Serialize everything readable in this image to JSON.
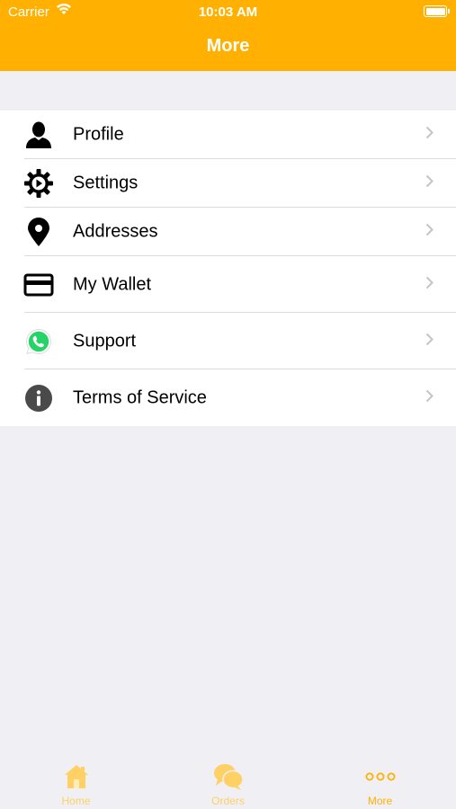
{
  "status_bar": {
    "carrier": "Carrier",
    "time": "10:03 AM"
  },
  "nav": {
    "title": "More"
  },
  "menu": {
    "items": [
      {
        "label": "Profile",
        "icon": "person-icon"
      },
      {
        "label": "Settings",
        "icon": "gear-icon"
      },
      {
        "label": "Addresses",
        "icon": "location-pin-icon"
      },
      {
        "label": "My Wallet",
        "icon": "credit-card-icon"
      },
      {
        "label": "Support",
        "icon": "whatsapp-icon"
      },
      {
        "label": "Terms of Service",
        "icon": "info-icon"
      }
    ]
  },
  "tabbar": {
    "tabs": [
      {
        "label": "Home",
        "icon": "home-icon"
      },
      {
        "label": "Orders",
        "icon": "chat-bubbles-icon"
      },
      {
        "label": "More",
        "icon": "more-dots-icon"
      }
    ]
  },
  "colors": {
    "accent": "#ffb000",
    "tab_inactive": "#ffd064",
    "background": "#efeff4",
    "whatsapp": "#25d366"
  }
}
